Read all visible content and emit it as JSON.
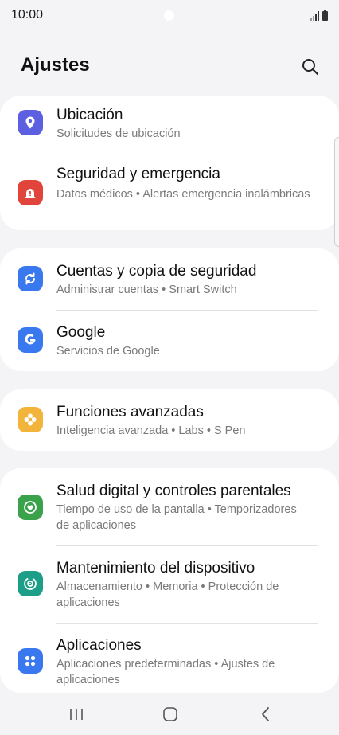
{
  "status_bar": {
    "time": "10:00"
  },
  "header": {
    "title": "Ajustes"
  },
  "colors": {
    "location": "#5b5fe0",
    "security": "#e0443a",
    "accounts": "#3a78ef",
    "google": "#3a78ef",
    "advanced": "#f3b43c",
    "digital_wellbeing": "#3aa24a",
    "device_care": "#1d9e87",
    "apps": "#3a78ef"
  },
  "items": [
    {
      "title": "Ubicación",
      "subtitle": "Solicitudes de ubicación",
      "icon": "location-pin-icon"
    },
    {
      "title": "Seguridad y emergencia",
      "subtitle": "Datos médicos  •  Alertas emergencia inalámbricas",
      "icon": "alert-icon"
    },
    {
      "title": "Cuentas y copia de seguridad",
      "subtitle": "Administrar cuentas  •  Smart Switch",
      "icon": "sync-icon"
    },
    {
      "title": "Google",
      "subtitle": "Servicios de Google",
      "icon": "google-icon"
    },
    {
      "title": "Funciones avanzadas",
      "subtitle": "Inteligencia avanzada  •  Labs  •  S Pen",
      "icon": "gear-flower-icon"
    },
    {
      "title": "Salud digital y controles parentales",
      "subtitle": "Tiempo de uso de la pantalla  •  Temporizadores de aplicaciones",
      "icon": "heart-circle-icon"
    },
    {
      "title": "Mantenimiento del dispositivo",
      "subtitle": "Almacenamiento  •  Memoria  •  Protección de aplicaciones",
      "icon": "device-care-icon"
    },
    {
      "title": "Aplicaciones",
      "subtitle": "Aplicaciones predeterminadas  •  Ajustes de aplicaciones",
      "icon": "apps-grid-icon"
    }
  ]
}
